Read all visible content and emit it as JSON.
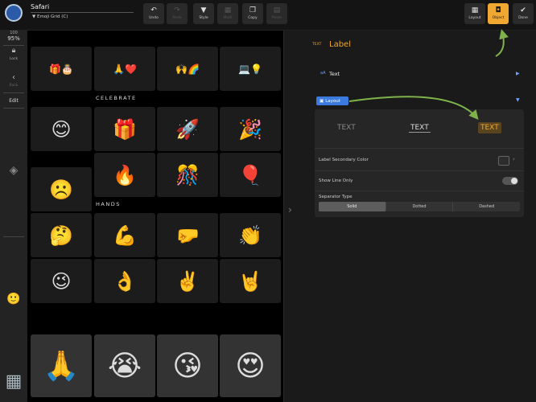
{
  "app": {
    "name": "Safari",
    "document": "Emoji Grid (C)"
  },
  "toolbar": {
    "undo": "Undo",
    "redo": "Redo",
    "style": "Style",
    "multi": "Multi",
    "copy": "Copy",
    "paste": "Paste",
    "layout": "Layout",
    "object": "Object",
    "done": "Done"
  },
  "rail": {
    "zoom_badge": "100",
    "zoom": "95%",
    "lock": "Lock",
    "back": "Back",
    "edit": "Edit"
  },
  "grid": {
    "top_row": [
      "🎁🎂",
      "🙏❤️",
      "🙌🌈",
      "💻💡"
    ],
    "celebrate_label": "CELEBRATE",
    "celebrate_row1": [
      "😊",
      "🎁",
      "🚀",
      "🎉"
    ],
    "celebrate_row2": [
      "🔥",
      "🎊",
      "🎈"
    ],
    "sad": "☹️",
    "hands_label": "HANDS",
    "hands_row1": [
      "🤔",
      "💪",
      "🤛",
      "👏"
    ],
    "hands_row2": [
      "😉",
      "👌",
      "✌️",
      "🤘"
    ],
    "bottom_row": [
      "🙏",
      "😭",
      "😘",
      "😍"
    ]
  },
  "panel": {
    "tag": "TEXT",
    "title": "Label",
    "text_icon": "aA",
    "text_row": "Text",
    "layout_row": "Layout",
    "variants": [
      "TEXT",
      "TEXT",
      "TEXT"
    ],
    "secondary_color": "Label Secondary Color",
    "show_line_only": "Show Line Only",
    "separator_type": "Separator Type",
    "separator_options": [
      "Solid",
      "Dotted",
      "Dashed"
    ],
    "separator_selected": "Solid"
  },
  "colors": {
    "accent": "#f0a830",
    "blue": "#3b7be0",
    "arrow": "#7fb24a"
  }
}
